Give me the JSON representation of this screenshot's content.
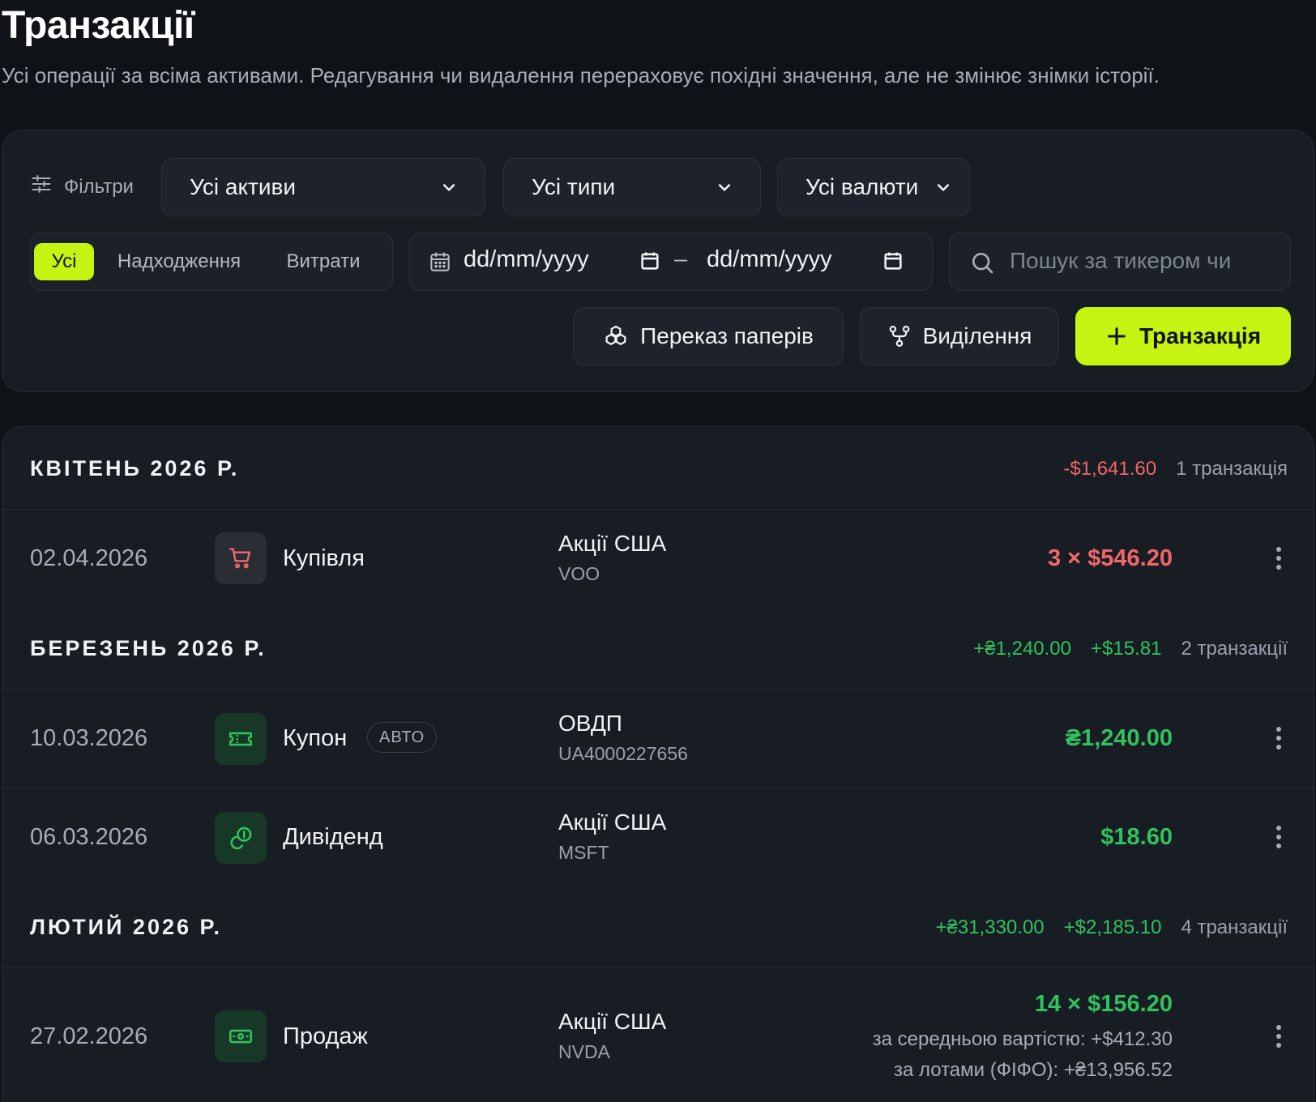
{
  "page": {
    "title": "Транзакції",
    "subtitle": "Усі операції за всіма активами. Редагування чи видалення перераховує похідні значення, але не змінює знімки історії."
  },
  "filters": {
    "label": "Фільтри",
    "asset_select": "Усі активи",
    "type_select": "Усі типи",
    "currency_select": "Усі валюти",
    "direction_tabs": [
      "Усі",
      "Надходження",
      "Витрати"
    ],
    "active_direction": "Усі",
    "date_from_placeholder": "dd/mm/yyyy",
    "date_to_placeholder": "dd/mm/yyyy",
    "date_separator": "–",
    "search_placeholder": "Пошук за тикером чи"
  },
  "actions": {
    "transfer_label": "Переказ паперів",
    "spinoff_label": "Виділення",
    "add_label": "Транзакція"
  },
  "colors": {
    "accent": "#c6f312",
    "negative": "#f0676b",
    "positive": "#2fc25f",
    "background": "#0f1217",
    "card": "#181c23"
  },
  "groups": [
    {
      "title": "КВІТЕНЬ 2026 Р.",
      "totals": [
        "-$1,641.60"
      ],
      "totals_sign": "negative",
      "count": "1 транзакція",
      "rows": [
        {
          "date": "02.04.2026",
          "icon": "cart-icon",
          "icon_tone": "red",
          "type": "Купівля",
          "asset": "Акції США",
          "ticker": "VOO",
          "amount": "3 × $546.20",
          "amount_sign": "negative"
        }
      ]
    },
    {
      "title": "БЕРЕЗЕНЬ 2026 Р.",
      "totals": [
        "+₴1,240.00",
        "+$15.81"
      ],
      "totals_sign": "positive",
      "count": "2 транзакції",
      "rows": [
        {
          "date": "10.03.2026",
          "icon": "ticket-icon",
          "icon_tone": "green",
          "type": "Купон",
          "badge": "АВТО",
          "asset": "ОВДП",
          "ticker": "UA4000227656",
          "amount": "₴1,240.00",
          "amount_sign": "positive"
        },
        {
          "date": "06.03.2026",
          "icon": "coins-icon",
          "icon_tone": "green",
          "type": "Дивіденд",
          "asset": "Акції США",
          "ticker": "MSFT",
          "amount": "$18.60",
          "amount_sign": "positive"
        }
      ]
    },
    {
      "title": "ЛЮТИЙ 2026 Р.",
      "totals": [
        "+₴31,330.00",
        "+$2,185.10"
      ],
      "totals_sign": "positive",
      "count": "4 транзакції",
      "rows": [
        {
          "date": "27.02.2026",
          "icon": "banknote-icon",
          "icon_tone": "green",
          "type": "Продаж",
          "asset": "Акції США",
          "ticker": "NVDA",
          "amount": "14 × $156.20",
          "amount_sign": "positive",
          "sub1": "за середньою вартістю: +$412.30",
          "sub2": "за лотами (ФІФО): +₴13,956.52"
        }
      ]
    }
  ]
}
